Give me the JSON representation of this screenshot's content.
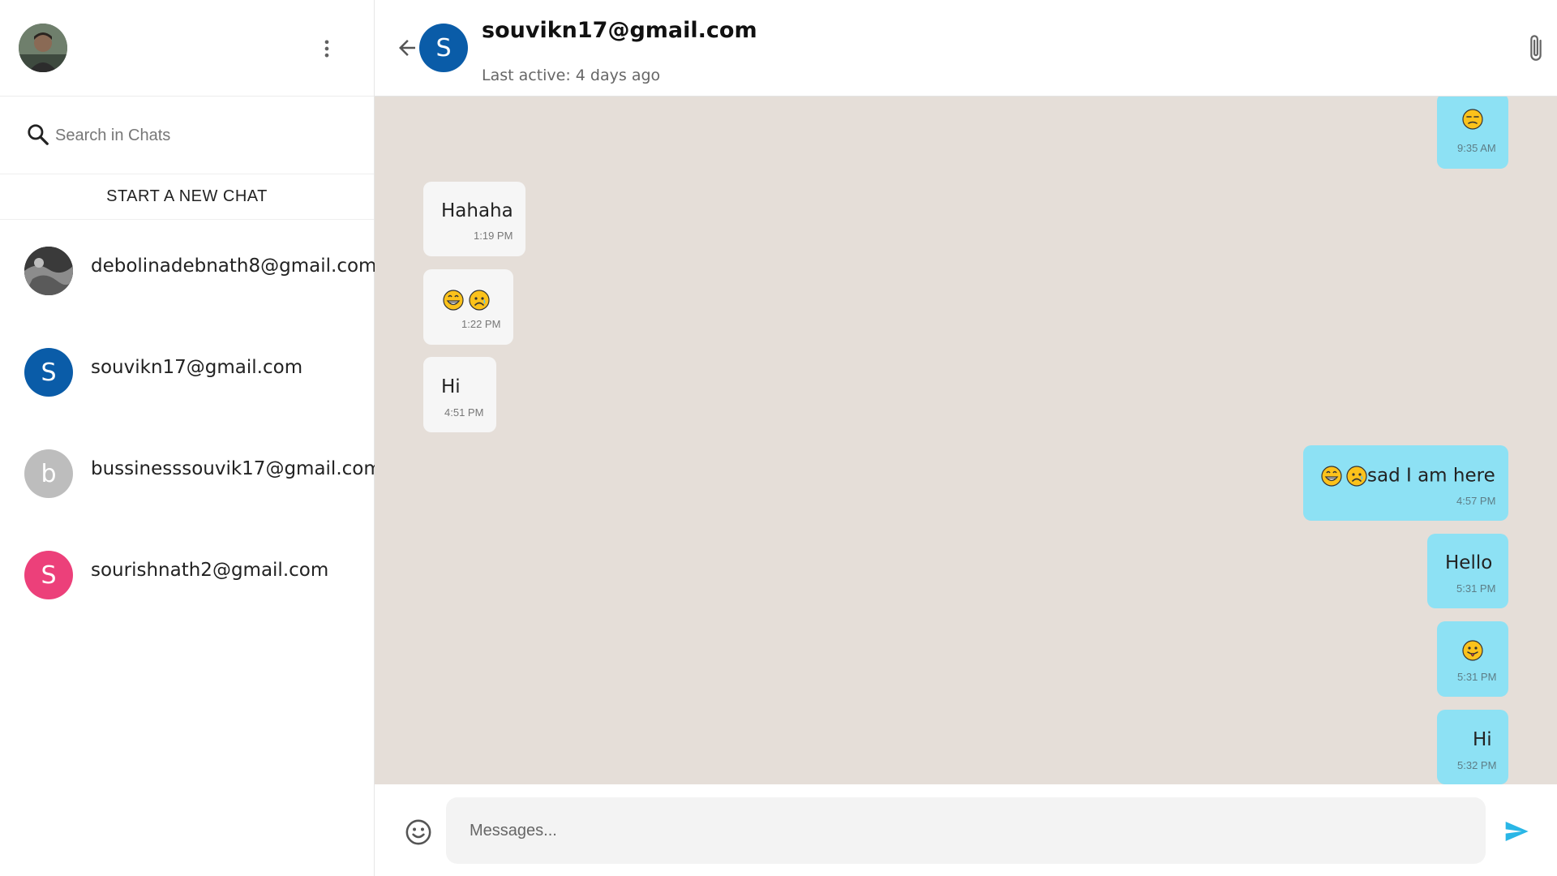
{
  "sidebar": {
    "search": {
      "placeholder": "Search in Chats"
    },
    "new_chat_label": "START A NEW CHAT",
    "contacts": [
      {
        "name": "debolinadebnath8@gmail.com",
        "initial": "",
        "color": "#2b2b2b"
      },
      {
        "name": "souvikn17@gmail.com",
        "initial": "S",
        "color": "#0a5ca8"
      },
      {
        "name": "bussinesssouvik17@gmail.com",
        "initial": "b",
        "color": "#bdbdbd"
      },
      {
        "name": "sourishnath2@gmail.com",
        "initial": "S",
        "color": "#ec407a"
      }
    ]
  },
  "chat": {
    "avatar_initial": "S",
    "avatar_color": "#0a5ca8",
    "name": "souvikn17@gmail.com",
    "status": "Last active: 4 days ago",
    "messages": [
      {
        "dir": "out",
        "emojis": [
          "unamused-emoji"
        ],
        "text": "",
        "time": "9:35 AM"
      },
      {
        "dir": "in",
        "emojis": [],
        "text": "Hahaha",
        "time": "1:19 PM"
      },
      {
        "dir": "in",
        "emojis": [
          "grin-emoji",
          "sad-emoji"
        ],
        "text": "",
        "time": "1:22 PM"
      },
      {
        "dir": "in",
        "emojis": [],
        "text": "Hi",
        "time": "4:51 PM"
      },
      {
        "dir": "out",
        "emojis": [
          "grin-emoji",
          "sad-emoji"
        ],
        "text": "sad I am here",
        "time": "4:57 PM"
      },
      {
        "dir": "out",
        "emojis": [],
        "text": "Hello",
        "time": "5:31 PM"
      },
      {
        "dir": "out",
        "emojis": [
          "tongue-emoji"
        ],
        "text": "",
        "time": "5:31 PM"
      },
      {
        "dir": "out",
        "emojis": [],
        "text": "Hi",
        "time": "5:32 PM"
      }
    ],
    "composer": {
      "placeholder": "Messages..."
    }
  },
  "colors": {
    "accent": "#0a5ca8",
    "outgoing_bubble": "#8de1f4",
    "incoming_bubble": "#f6f6f6",
    "chat_background": "#e5ded8",
    "send_icon": "#29b6e6"
  },
  "icons": [
    "chat-icon",
    "more-vert-icon",
    "search-icon",
    "arrow-back-icon",
    "attach-icon",
    "emoji-icon",
    "send-icon"
  ]
}
